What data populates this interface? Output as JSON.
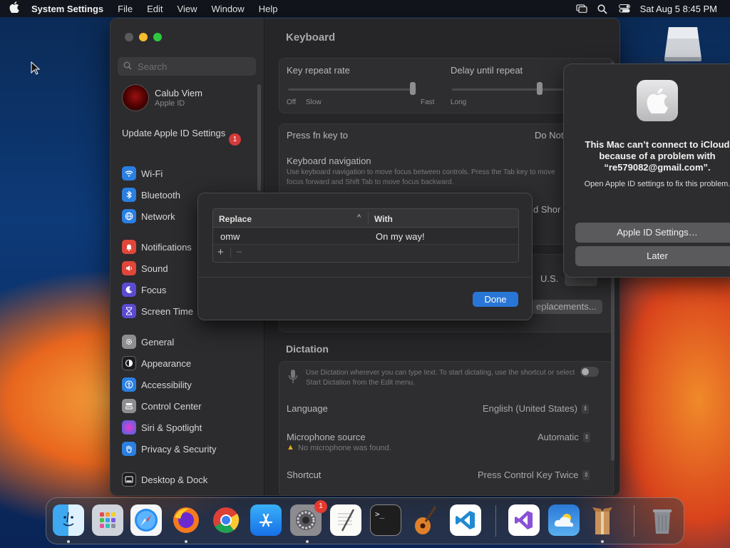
{
  "menubar": {
    "app_name": "System Settings",
    "menus": [
      "File",
      "Edit",
      "View",
      "Window",
      "Help"
    ],
    "clock": "Sat Aug 5  8:45 PM"
  },
  "sidebar": {
    "search_placeholder": "Search",
    "profile": {
      "name": "Calub Viem",
      "sub": "Apple ID"
    },
    "update": {
      "label": "Update Apple ID Settings",
      "badge": "1"
    },
    "items": [
      {
        "label": "Wi-Fi",
        "icon": "wifi-icon",
        "color": "#2a7fe0"
      },
      {
        "label": "Bluetooth",
        "icon": "bluetooth-icon",
        "color": "#2a7fe0"
      },
      {
        "label": "Network",
        "icon": "globe-icon",
        "color": "#2a7fe0"
      },
      {
        "label": "Notifications",
        "icon": "bell-icon",
        "color": "#e0463a"
      },
      {
        "label": "Sound",
        "icon": "speaker-icon",
        "color": "#e0463a"
      },
      {
        "label": "Focus",
        "icon": "moon-icon",
        "color": "#5a4bd0"
      },
      {
        "label": "Screen Time",
        "icon": "hourglass-icon",
        "color": "#5a4bd0"
      },
      {
        "label": "General",
        "icon": "gear-icon",
        "color": "#8e8e92"
      },
      {
        "label": "Appearance",
        "icon": "appearance-icon",
        "color": "#1c1c1e"
      },
      {
        "label": "Accessibility",
        "icon": "accessibility-icon",
        "color": "#2a7fe0"
      },
      {
        "label": "Control Center",
        "icon": "control-center-icon",
        "color": "#8e8e92"
      },
      {
        "label": "Siri & Spotlight",
        "icon": "siri-icon",
        "color": "#c03ad0"
      },
      {
        "label": "Privacy & Security",
        "icon": "hand-icon",
        "color": "#2a7fe0"
      },
      {
        "label": "Desktop & Dock",
        "icon": "dock-icon",
        "color": "#1c1c1e"
      }
    ]
  },
  "main": {
    "title": "Keyboard",
    "key_repeat": {
      "label": "Key repeat rate",
      "left": "Off",
      "left2": "Slow",
      "right": "Fast"
    },
    "delay": {
      "label": "Delay until repeat",
      "left": "Long"
    },
    "fn_key": {
      "label": "Press fn key to",
      "value": "Do Not"
    },
    "nav": {
      "label": "Keyboard navigation",
      "desc": "Use keyboard navigation to move focus between controls. Press the Tab key to move focus forward and Shift Tab to move focus backward."
    },
    "shortcuts_btn": "d Shor",
    "input_source_value": "U.S.",
    "text_replacements_btn": "eplacements...",
    "dictation": {
      "heading": "Dictation",
      "desc": "Use Dictation wherever you can type text. To start dictating, use the shortcut or select Start Dictation from the Edit menu.",
      "language_label": "Language",
      "language_value": "English (United States)",
      "mic_label": "Microphone source",
      "mic_value": "Automatic",
      "mic_warning": "No microphone was found.",
      "shortcut_label": "Shortcut",
      "shortcut_value": "Press Control Key Twice"
    }
  },
  "sheet": {
    "col_replace": "Replace",
    "col_with": "With",
    "rows": [
      {
        "replace": "omw",
        "with": "On my way!"
      }
    ],
    "add": "+",
    "remove": "−",
    "done": "Done"
  },
  "alert": {
    "title": "This Mac can’t connect to iCloud because of a problem with “re579082@gmail.com”.",
    "message": "Open Apple ID settings to fix this problem.",
    "primary": "Apple ID Settings…",
    "secondary": "Later"
  },
  "dock": {
    "apps": [
      "finder-icon",
      "launchpad-icon",
      "safari-icon",
      "firefox-icon",
      "chrome-icon",
      "app-store-icon",
      "system-settings-icon",
      "textedit-icon",
      "terminal-icon",
      "garageband-icon",
      "vscode-icon",
      "visual-studio-icon",
      "weather-icon",
      "archive-utility-icon",
      "trash-icon"
    ],
    "settings_badge": "1"
  }
}
